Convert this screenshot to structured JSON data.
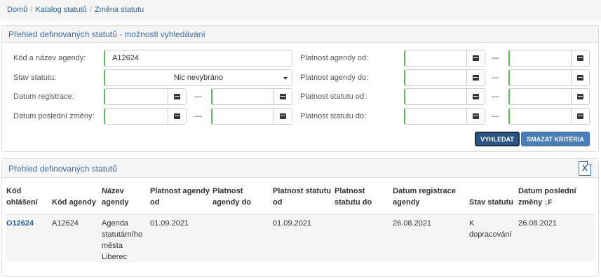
{
  "breadcrumb": {
    "home": "Domů",
    "catalog": "Katalog statutů",
    "current": "Změna statutu",
    "separator": "/"
  },
  "search": {
    "title": "Přehled definovaných statutů - možnosti vyhledávání",
    "agenda_code_label": "Kód a název agendy:",
    "agenda_code_value": "A12624",
    "status_label": "Stav statutu:",
    "status_value": "Nic nevybráno",
    "registration_label": "Datum registrace:",
    "last_change_label": "Datum poslední změny:",
    "agenda_valid_from_label": "Platnost agendy od:",
    "agenda_valid_to_label": "Platnost agendy do:",
    "statute_valid_from_label": "Platnost statutu od:",
    "statute_valid_to_label": "Platnost statutu do:",
    "range_dash": "—",
    "search_button": "VYHLEDAT",
    "clear_button": "SMAZAT KRITÉRIA"
  },
  "results": {
    "title": "Přehled definovaných statutů",
    "export_icon": "excel-icon",
    "columns": [
      "Kód ohlášení",
      "Kód agendy",
      "Název agendy",
      "Platnost agendy od",
      "Platnost agendy do",
      "Platnost statutu od",
      "Platnost statutu do",
      "Datum registrace agendy",
      "Stav statutu",
      "Datum poslední změny"
    ],
    "sort_indicator": "↓F",
    "rows": [
      {
        "code": "O12624",
        "agenda_code": "A12624",
        "agenda_name": "Agenda statutárního města Liberec",
        "agenda_from": "01.09.2021",
        "agenda_to": "",
        "statute_from": "01.09.2021",
        "statute_to": "",
        "registration": "26.08.2021",
        "status": "K dopracování",
        "last_change": "26.08.2021"
      }
    ]
  },
  "colors": {
    "accent": "#3b6ea5",
    "valid_border": "#5cb85c",
    "button": "#4a7eb8"
  }
}
